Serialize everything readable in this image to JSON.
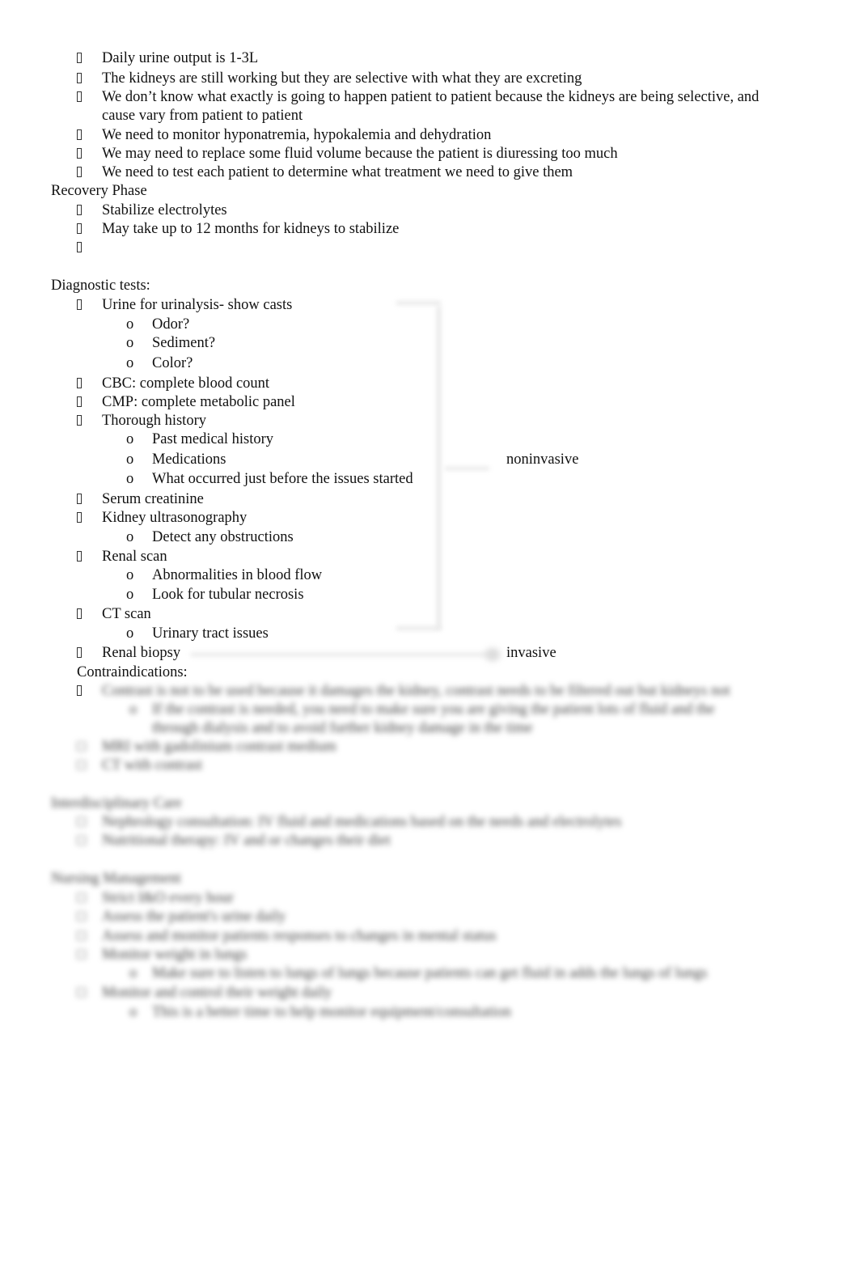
{
  "document": {
    "oliguric_followup_bullets": [
      {
        "text": "Daily urine output is 1-3L"
      },
      {
        "text": "The kidneys are still working but they are selective with what they are excreting"
      },
      {
        "text": "We don’t know what exactly is going to happen patient to patient because the kidneys are being selective, and",
        "continuation": "cause vary from patient to patient"
      },
      {
        "text": "We need to monitor hyponatremia, hypokalemia and dehydration"
      },
      {
        "text": "We may need to replace some fluid volume because the patient is diuressing too much"
      },
      {
        "text": "We need to test each patient to determine what treatment we need to give them"
      }
    ],
    "recovery": {
      "heading": "Recovery Phase",
      "bullets": [
        "Stabilize electrolytes",
        "May take up to 12 months for kidneys to stabilize",
        ""
      ]
    },
    "diagnostics": {
      "heading": "Diagnostic tests:",
      "items": [
        {
          "text": "Urine for urinalysis- show casts",
          "sub": [
            "Odor?",
            "Sediment?",
            "Color?"
          ]
        },
        {
          "text": "CBC: complete blood count",
          "sub": []
        },
        {
          "text": "CMP: complete metabolic panel",
          "sub": []
        },
        {
          "text": "Thorough history",
          "sub": [
            "Past medical history",
            "Medications",
            "What occurred just before the issues started"
          ]
        },
        {
          "text": "Serum creatinine",
          "sub": []
        },
        {
          "text": "Kidney ultrasonography",
          "sub": [
            "Detect any obstructions"
          ]
        },
        {
          "text": "Renal scan",
          "sub": [
            "Abnormalities in blood flow",
            "Look for tubular necrosis"
          ]
        },
        {
          "text": "CT scan",
          "sub": [
            "Urinary tract issues"
          ]
        },
        {
          "text": "Renal biopsy",
          "sub": []
        }
      ],
      "noninvasive_label": "noninvasive",
      "invasive_label": "invasive",
      "contraindications_heading": "Contraindications:"
    },
    "markers": {
      "bullet_glyph": "missing-glyph-box",
      "sub_bullet": "o"
    },
    "blurred_placeholder": {
      "line1": "Contrast is not to be used because it damages the kidney, contrast needs to be filtered out but kidneys not",
      "line2": "If the contrast is needed, you need to make sure you are giving the patient lots of fluid and the",
      "line3": "through dialysis and to avoid further kidney damage in the time",
      "line4": "MRI with gadolinium contrast medium",
      "line5": "CT with contrast",
      "heading2": "Interdisciplinary Care",
      "line6": "Nephrology consultation: IV fluid and medications based on the needs and electrolytes",
      "line7": "Nutritional therapy: IV and or changes their diet",
      "heading3": "Nursing Management",
      "line8": "Strict I&O every hour",
      "line9": "Assess the patient's urine daily",
      "line10": "Assess and monitor patients responses to changes in mental status",
      "line11": "Monitor weight in lungs",
      "line12": "Make sure to listen to lungs of lungs because patients can get fluid in adds the lungs of lungs",
      "line13": "Monitor and control their weight daily",
      "line14": "This is a better time to help monitor equipment/consultation"
    }
  }
}
